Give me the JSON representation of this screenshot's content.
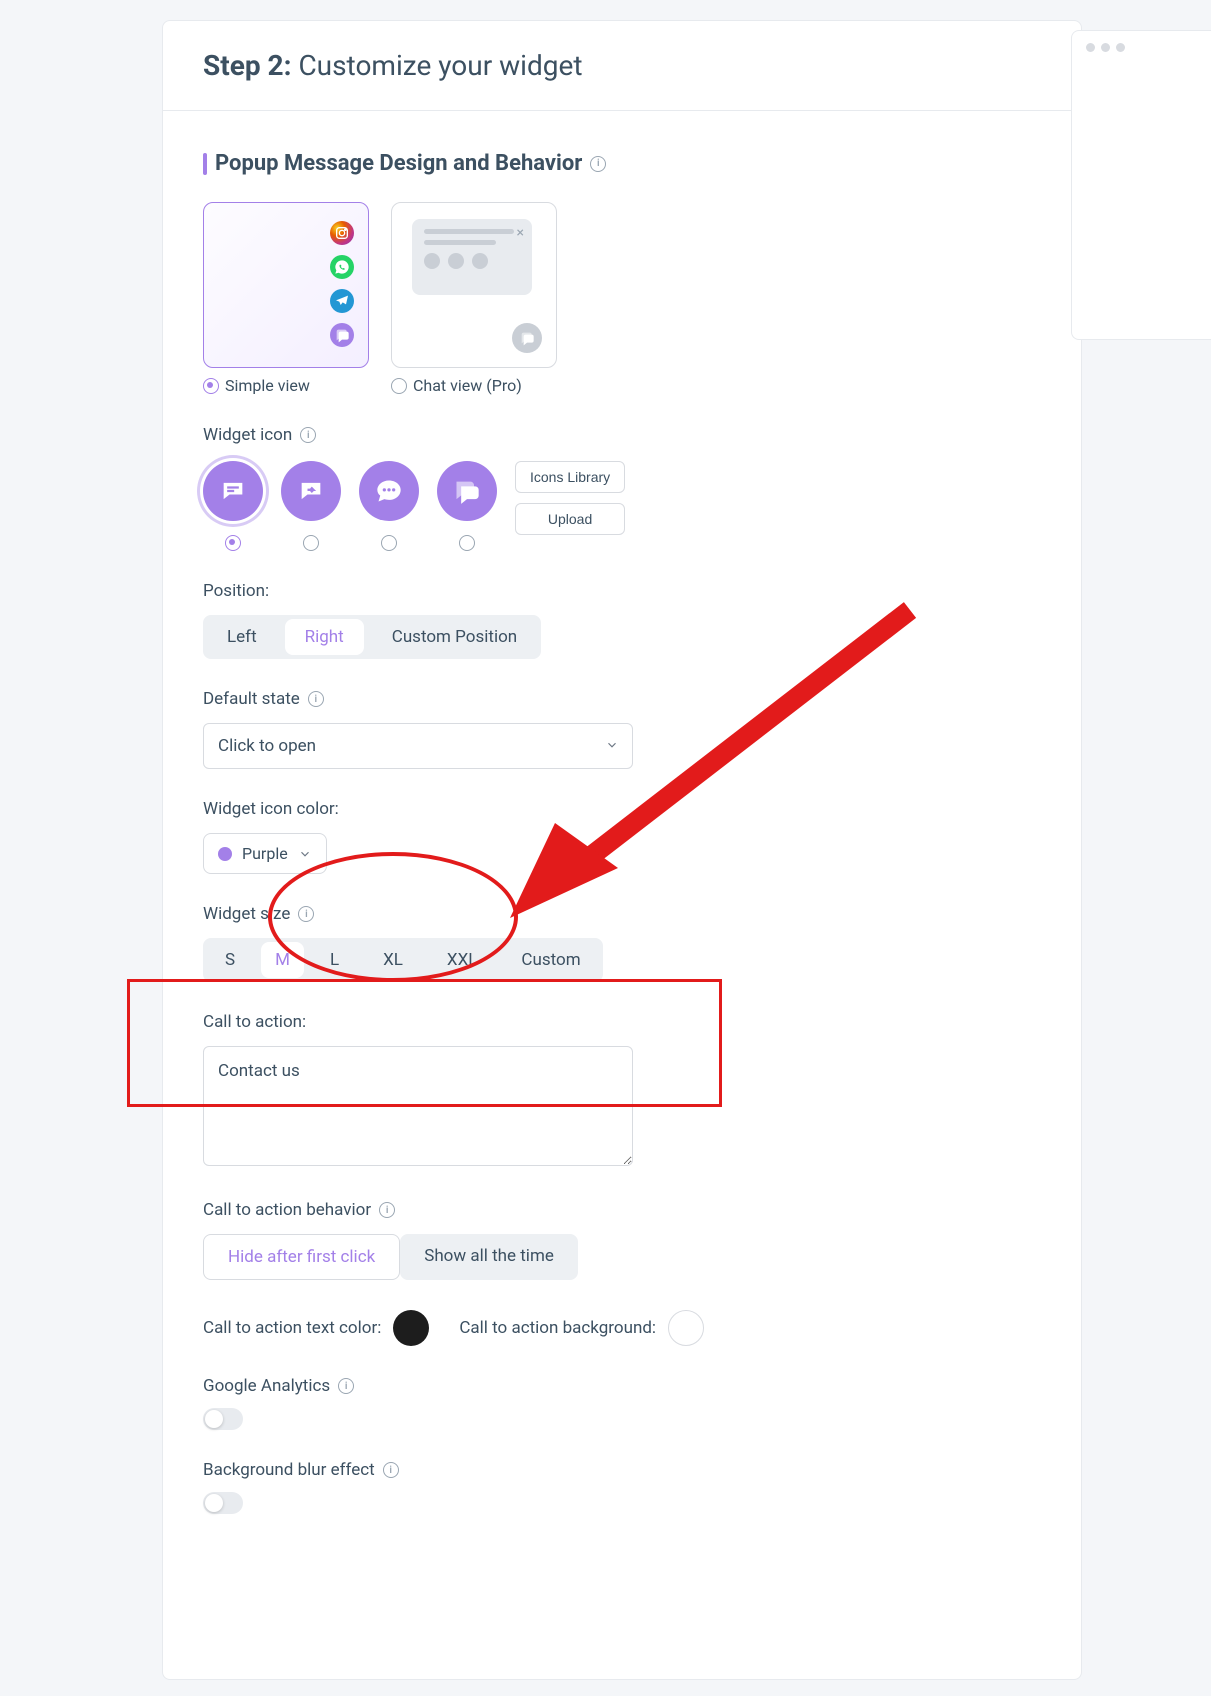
{
  "header": {
    "step_bold": "Step 2:",
    "step_rest": " Customize your widget"
  },
  "section": {
    "title": "Popup Message Design and Behavior"
  },
  "views": {
    "simple": "Simple view",
    "chat": "Chat view (Pro)"
  },
  "widget_icon": {
    "label": "Widget icon",
    "buttons": {
      "library": "Icons Library",
      "upload": "Upload"
    }
  },
  "position": {
    "label": "Position:",
    "options": {
      "left": "Left",
      "right": "Right",
      "custom": "Custom Position"
    }
  },
  "default_state": {
    "label": "Default state",
    "value": "Click to open"
  },
  "icon_color": {
    "label": "Widget icon color:",
    "value": "Purple"
  },
  "widget_size": {
    "label": "Widget size",
    "options": {
      "s": "S",
      "m": "M",
      "l": "L",
      "xl": "XL",
      "xxl": "XXL",
      "custom": "Custom"
    }
  },
  "cta": {
    "label": "Call to action:",
    "value": "Contact us"
  },
  "cta_behavior": {
    "label": "Call to action behavior",
    "hide": "Hide after first click",
    "show": "Show all the time"
  },
  "cta_colors": {
    "text_label": "Call to action text color:",
    "bg_label": "Call to action background:"
  },
  "analytics": {
    "label": "Google Analytics"
  },
  "blur": {
    "label": "Background blur effect"
  }
}
